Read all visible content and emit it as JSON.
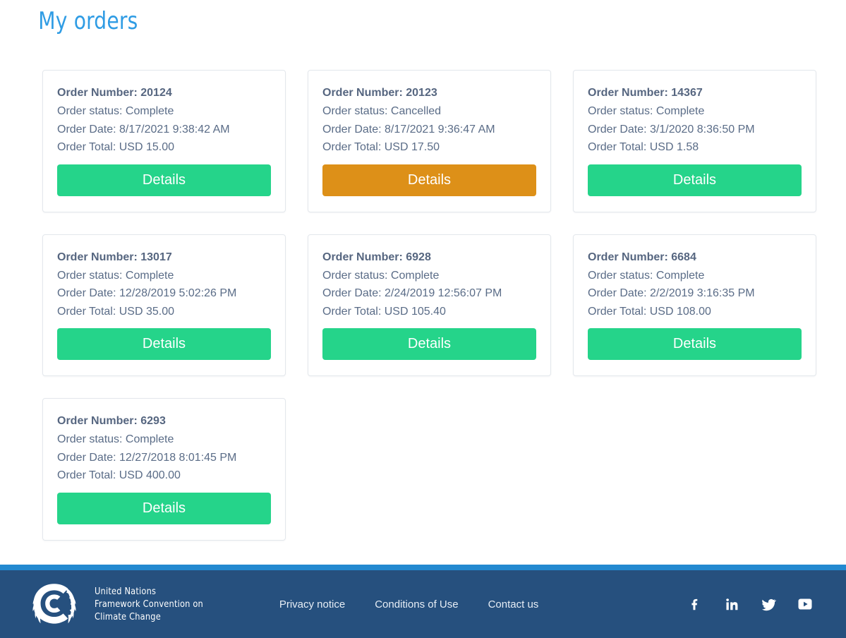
{
  "page": {
    "title": "My orders",
    "title_color": "#2f9ce4",
    "background": "#ffffff"
  },
  "labels": {
    "order_number_prefix": "Order Number: ",
    "order_status_prefix": "Order status: ",
    "order_date_prefix": "Order Date: ",
    "order_total_prefix": "Order Total: ",
    "details_button": "Details"
  },
  "colors": {
    "button_complete": "#25d48a",
    "button_cancelled": "#dd9018",
    "card_text": "#5a6c87",
    "card_border": "#e3e7ec",
    "footer_accent": "#2389d0",
    "footer_background": "#26507e"
  },
  "orders": [
    {
      "number_line": "Order Number: 20124",
      "status_line": "Order status: Complete",
      "date_line": "Order Date: 8/17/2021 9:38:42 AM",
      "total_line": "Order Total: USD 15.00",
      "button_label": "Details",
      "status": "Complete",
      "number": "20124",
      "date": "8/17/2021 9:38:42 AM",
      "total": "USD 15.00",
      "button_style": "green"
    },
    {
      "number_line": "Order Number: 20123",
      "status_line": "Order status: Cancelled",
      "date_line": "Order Date: 8/17/2021 9:36:47 AM",
      "total_line": "Order Total: USD 17.50",
      "button_label": "Details",
      "status": "Cancelled",
      "number": "20123",
      "date": "8/17/2021 9:36:47 AM",
      "total": "USD 17.50",
      "button_style": "orange"
    },
    {
      "number_line": "Order Number: 14367",
      "status_line": "Order status: Complete",
      "date_line": "Order Date: 3/1/2020 8:36:50 PM",
      "total_line": "Order Total: USD 1.58",
      "button_label": "Details",
      "status": "Complete",
      "number": "14367",
      "date": "3/1/2020 8:36:50 PM",
      "total": "USD 1.58",
      "button_style": "green"
    },
    {
      "number_line": "Order Number: 13017",
      "status_line": "Order status: Complete",
      "date_line": "Order Date: 12/28/2019 5:02:26 PM",
      "total_line": "Order Total: USD 35.00",
      "button_label": "Details",
      "status": "Complete",
      "number": "13017",
      "date": "12/28/2019 5:02:26 PM",
      "total": "USD 35.00",
      "button_style": "green"
    },
    {
      "number_line": "Order Number: 6928",
      "status_line": "Order status: Complete",
      "date_line": "Order Date: 2/24/2019 12:56:07 PM",
      "total_line": "Order Total: USD 105.40",
      "button_label": "Details",
      "status": "Complete",
      "number": "6928",
      "date": "2/24/2019 12:56:07 PM",
      "total": "USD 105.40",
      "button_style": "green"
    },
    {
      "number_line": "Order Number: 6684",
      "status_line": "Order status: Complete",
      "date_line": "Order Date: 2/2/2019 3:16:35 PM",
      "total_line": "Order Total: USD 108.00",
      "button_label": "Details",
      "status": "Complete",
      "number": "6684",
      "date": "2/2/2019 3:16:35 PM",
      "total": "USD 108.00",
      "button_style": "green"
    },
    {
      "number_line": "Order Number: 6293",
      "status_line": "Order status: Complete",
      "date_line": "Order Date: 12/27/2018 8:01:45 PM",
      "total_line": "Order Total: USD 400.00",
      "button_label": "Details",
      "status": "Complete",
      "number": "6293",
      "date": "12/27/2018 8:01:45 PM",
      "total": "USD 400.00",
      "button_style": "green"
    }
  ],
  "footer": {
    "logo_icon": "unfccc-logo-icon",
    "brand_line1": "United Nations",
    "brand_line2": "Framework Convention on",
    "brand_line3": "Climate Change",
    "links": [
      {
        "label": "Privacy notice",
        "name": "privacy-notice"
      },
      {
        "label": "Conditions of Use",
        "name": "conditions-of-use"
      },
      {
        "label": "Contact us",
        "name": "contact-us"
      }
    ],
    "social": [
      {
        "icon": "facebook-icon",
        "label": "Facebook"
      },
      {
        "icon": "linkedin-icon",
        "label": "LinkedIn"
      },
      {
        "icon": "twitter-icon",
        "label": "Twitter"
      },
      {
        "icon": "youtube-icon",
        "label": "YouTube"
      }
    ]
  }
}
